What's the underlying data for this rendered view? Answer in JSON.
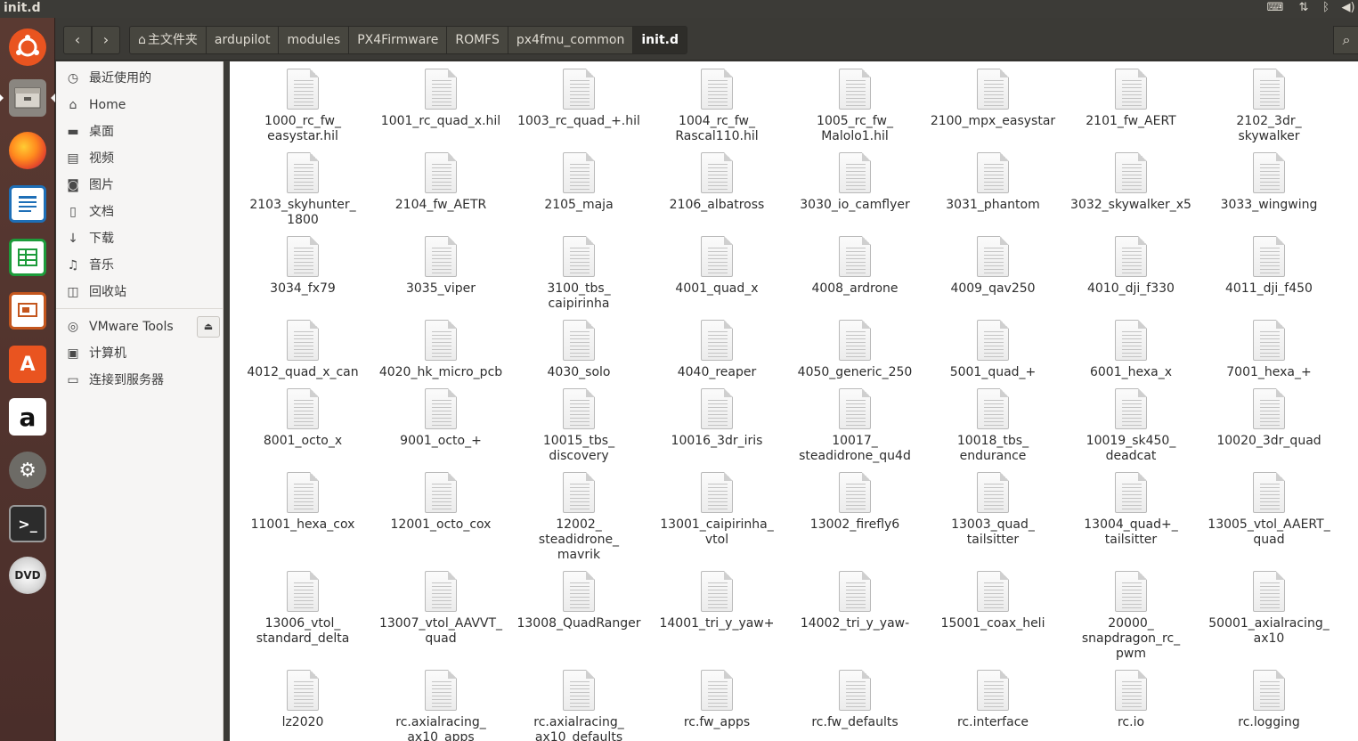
{
  "window": {
    "title": "init.d"
  },
  "colors": {
    "panel": "#3c3b37",
    "launcher": "#5a3a32",
    "sidebar": "#f6f5f4",
    "content": "#ffffff",
    "accent": "#e95420"
  },
  "tray_icons": [
    "keyboard-icon",
    "network-icon",
    "bluetooth-icon",
    "volume-icon"
  ],
  "launcher": [
    {
      "name": "ubuntu-dash-icon"
    },
    {
      "name": "files-icon"
    },
    {
      "name": "firefox-icon"
    },
    {
      "name": "libreoffice-writer-icon"
    },
    {
      "name": "libreoffice-calc-icon"
    },
    {
      "name": "libreoffice-impress-icon"
    },
    {
      "name": "software-center-icon"
    },
    {
      "name": "amazon-icon"
    },
    {
      "name": "system-settings-icon"
    },
    {
      "name": "terminal-icon"
    },
    {
      "name": "dvd-icon"
    }
  ],
  "breadcrumb": [
    "主文件夹",
    "ardupilot",
    "modules",
    "PX4Firmware",
    "ROMFS",
    "px4fmu_common",
    "init.d"
  ],
  "sidebar": {
    "places": [
      {
        "label": "最近使用的",
        "icon": "clock-icon"
      },
      {
        "label": "Home",
        "icon": "home-icon"
      },
      {
        "label": "桌面",
        "icon": "folder-icon"
      },
      {
        "label": "视频",
        "icon": "video-icon"
      },
      {
        "label": "图片",
        "icon": "camera-icon"
      },
      {
        "label": "文档",
        "icon": "document-icon"
      },
      {
        "label": "下载",
        "icon": "download-icon"
      },
      {
        "label": "音乐",
        "icon": "music-icon"
      },
      {
        "label": "回收站",
        "icon": "trash-icon"
      }
    ],
    "devices": [
      {
        "label": "VMware Tools",
        "icon": "disc-icon"
      },
      {
        "label": "计算机",
        "icon": "computer-icon"
      },
      {
        "label": "连接到服务器",
        "icon": "server-icon"
      }
    ]
  },
  "files": [
    "1000_rc_fw_\neasystar.hil",
    "1001_rc_quad_x.hil",
    "1003_rc_quad_+.hil",
    "1004_rc_fw_\nRascal110.hil",
    "1005_rc_fw_\nMalolo1.hil",
    "2100_mpx_easystar",
    "2101_fw_AERT",
    "2102_3dr_\nskywalker",
    "2103_skyhunter_\n1800",
    "2104_fw_AETR",
    "2105_maja",
    "2106_albatross",
    "3030_io_camflyer",
    "3031_phantom",
    "3032_skywalker_x5",
    "3033_wingwing",
    "3034_fx79",
    "3035_viper",
    "3100_tbs_\ncaipirinha",
    "4001_quad_x",
    "4008_ardrone",
    "4009_qav250",
    "4010_dji_f330",
    "4011_dji_f450",
    "4012_quad_x_can",
    "4020_hk_micro_pcb",
    "4030_solo",
    "4040_reaper",
    "4050_generic_250",
    "5001_quad_+",
    "6001_hexa_x",
    "7001_hexa_+",
    "8001_octo_x",
    "9001_octo_+",
    "10015_tbs_\ndiscovery",
    "10016_3dr_iris",
    "10017_\nsteadidrone_qu4d",
    "10018_tbs_\nendurance",
    "10019_sk450_\ndeadcat",
    "10020_3dr_quad",
    "11001_hexa_cox",
    "12001_octo_cox",
    "12002_\nsteadidrone_\nmavrik",
    "13001_caipirinha_\nvtol",
    "13002_firefly6",
    "13003_quad_\ntailsitter",
    "13004_quad+_\ntailsitter",
    "13005_vtol_AAERT_\nquad",
    "13006_vtol_\nstandard_delta",
    "13007_vtol_AAVVT_\nquad",
    "13008_QuadRanger",
    "14001_tri_y_yaw+",
    "14002_tri_y_yaw-",
    "15001_coax_heli",
    "20000_\nsnapdragon_rc_\npwm",
    "50001_axialracing_\nax10",
    "lz2020",
    "rc.axialracing_\nax10_apps",
    "rc.axialracing_\nax10_defaults",
    "rc.fw_apps",
    "rc.fw_defaults",
    "rc.interface",
    "rc.io",
    "rc.logging"
  ]
}
